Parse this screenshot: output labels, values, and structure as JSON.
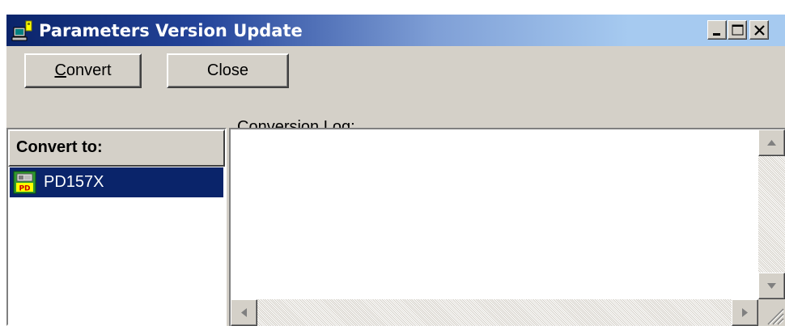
{
  "window": {
    "title": "Parameters Version Update",
    "app_icon": "computer-config-icon",
    "controls": {
      "minimize_icon": "minimize-icon",
      "maximize_icon": "maximize-icon",
      "close_icon": "close-icon"
    }
  },
  "toolbar": {
    "convert_label_mnemonic": "C",
    "convert_label_rest": "onvert",
    "close_label": "Close"
  },
  "log": {
    "label": "Conversion Log:",
    "content": ""
  },
  "convert_to": {
    "header": "Convert to:",
    "items": [
      {
        "label": "PD157X",
        "icon": "pd-device-icon",
        "selected": true
      }
    ]
  },
  "colors": {
    "title_gradient_start": "#0a246a",
    "title_gradient_end": "#a6caf0",
    "face": "#d4d0c8",
    "selection": "#0a246a"
  }
}
